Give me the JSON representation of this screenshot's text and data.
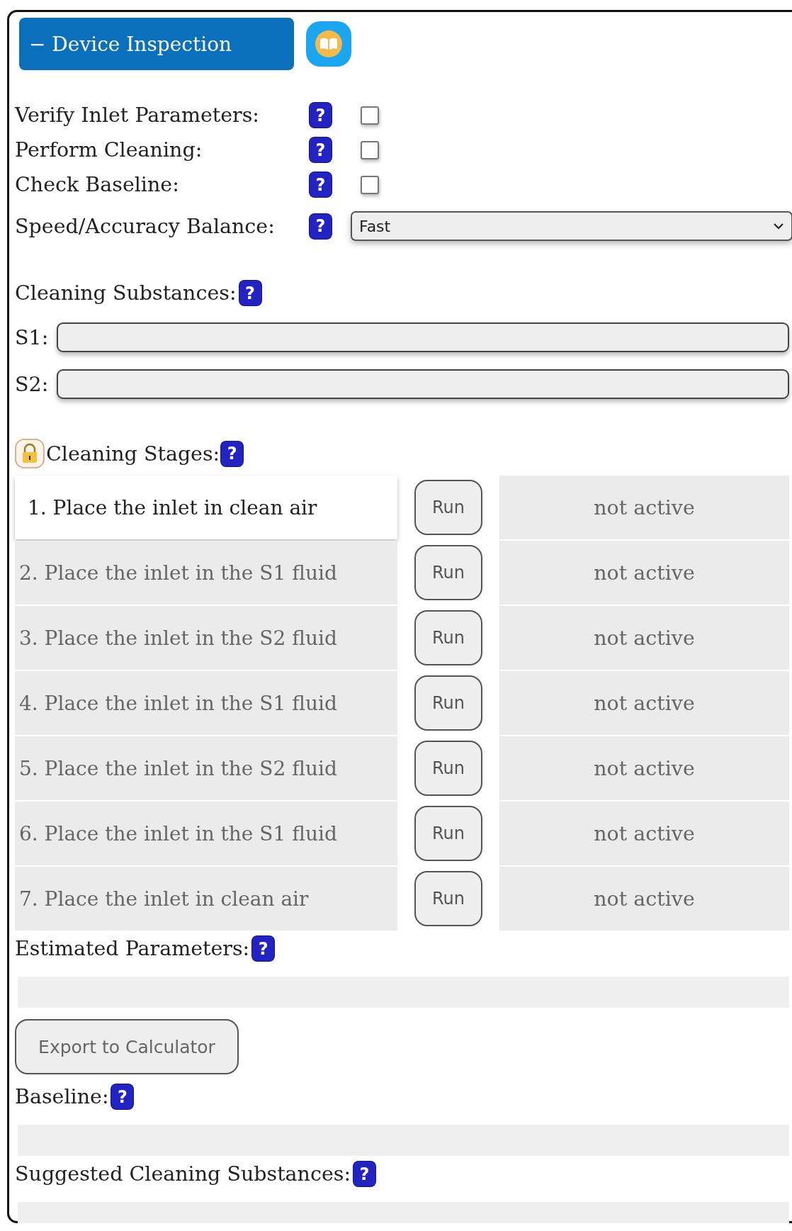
{
  "header": {
    "toggle": "−",
    "title": "Device Inspection"
  },
  "options": [
    {
      "kind": "checkbox",
      "label": "Verify Inlet Parameters:",
      "help": "?",
      "checked": false
    },
    {
      "kind": "checkbox",
      "label": "Perform Cleaning:",
      "help": "?",
      "checked": false
    },
    {
      "kind": "checkbox",
      "label": "Check Baseline:",
      "help": "?",
      "checked": false
    },
    {
      "kind": "select",
      "label": "Speed/Accuracy Balance:",
      "help": "?",
      "value": "Fast"
    }
  ],
  "substances": {
    "label": "Cleaning Substances:",
    "help": "?",
    "fields": [
      {
        "label": "S1:"
      },
      {
        "label": "S2:"
      }
    ]
  },
  "stages": {
    "label": "Cleaning Stages:",
    "help": "?",
    "items": [
      {
        "text": "1. Place the inlet in clean air",
        "button": "Run",
        "status": "not active",
        "selected": true
      },
      {
        "text": "2. Place the inlet in the S1 fluid",
        "button": "Run",
        "status": "not active",
        "selected": false
      },
      {
        "text": "3. Place the inlet in the S2 fluid",
        "button": "Run",
        "status": "not active",
        "selected": false
      },
      {
        "text": "4. Place the inlet in the S1 fluid",
        "button": "Run",
        "status": "not active",
        "selected": false
      },
      {
        "text": "5. Place the inlet in the S2 fluid",
        "button": "Run",
        "status": "not active",
        "selected": false
      },
      {
        "text": "6. Place the inlet in the S1 fluid",
        "button": "Run",
        "status": "not active",
        "selected": false
      },
      {
        "text": "7. Place the inlet in clean air",
        "button": "Run",
        "status": "not active",
        "selected": false
      }
    ]
  },
  "estimated": {
    "label": "Estimated Parameters:",
    "help": "?"
  },
  "export_button": "Export to Calculator",
  "baseline": {
    "label": "Baseline:",
    "help": "?"
  },
  "suggested": {
    "label": "Suggested Cleaning Substances:",
    "help": "?"
  }
}
